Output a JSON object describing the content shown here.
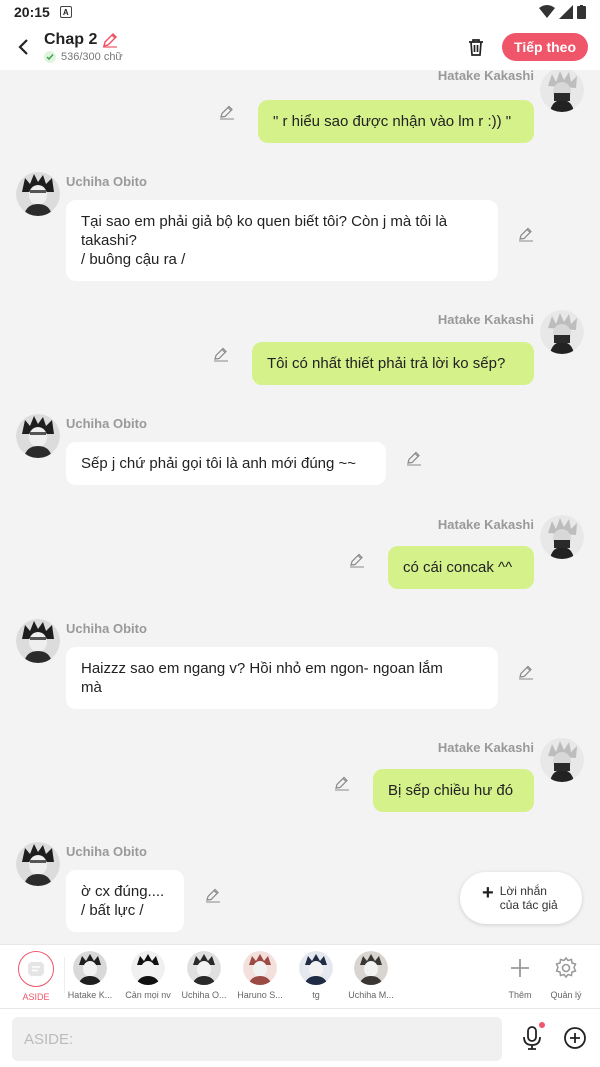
{
  "status_bar": {
    "time": "20:15",
    "a_badge": "A"
  },
  "header": {
    "title": "Chap 2",
    "subtitle": "536/300 chữ",
    "next_label": "Tiếp theo"
  },
  "messages": [
    {
      "side": "me",
      "name": "Hatake Kakashi",
      "lines": [
        "\" r hiểu sao được nhận vào lm r :)) \""
      ]
    },
    {
      "side": "other",
      "name": "Uchiha Obito",
      "lines": [
        "Tại sao em phải giả bộ ko quen biết tôi? Còn j mà tôi là",
        "takashi?",
        "/ buông cậu ra /"
      ]
    },
    {
      "side": "me",
      "name": "Hatake Kakashi",
      "lines": [
        "Tôi có nhất thiết phải trả lời ko sếp?"
      ]
    },
    {
      "side": "other",
      "name": "Uchiha Obito",
      "lines": [
        "Sếp j chứ phải gọi tôi là anh mới đúng ~~"
      ]
    },
    {
      "side": "me",
      "name": "Hatake Kakashi",
      "lines": [
        "có cái concak ^^"
      ]
    },
    {
      "side": "other",
      "name": "Uchiha Obito",
      "lines": [
        "Haizzz sao em ngang v? Hồi nhỏ em ngon- ngoan lắm",
        "mà"
      ]
    },
    {
      "side": "me",
      "name": "Hatake Kakashi",
      "lines": [
        "Bị sếp chiều hư đó"
      ]
    },
    {
      "side": "other",
      "name": "Uchiha Obito",
      "lines": [
        "ờ cx đúng....",
        "/ bất lực /"
      ]
    }
  ],
  "float_note": {
    "line1": "Lời nhắn",
    "line2": "của tác giả"
  },
  "char_bar": {
    "aside_label": "ASIDE",
    "characters": [
      "Hatake K...",
      "Cản mọi nv",
      "Uchiha O...",
      "Haruno S...",
      "tg",
      "Uchiha M..."
    ],
    "add_label": "Thêm",
    "manage_label": "Quản lý"
  },
  "input": {
    "placeholder": "ASIDE:"
  },
  "colors": {
    "accent": "#f0566a",
    "my_bubble": "#d4f18a",
    "background": "#f3f3f3"
  }
}
